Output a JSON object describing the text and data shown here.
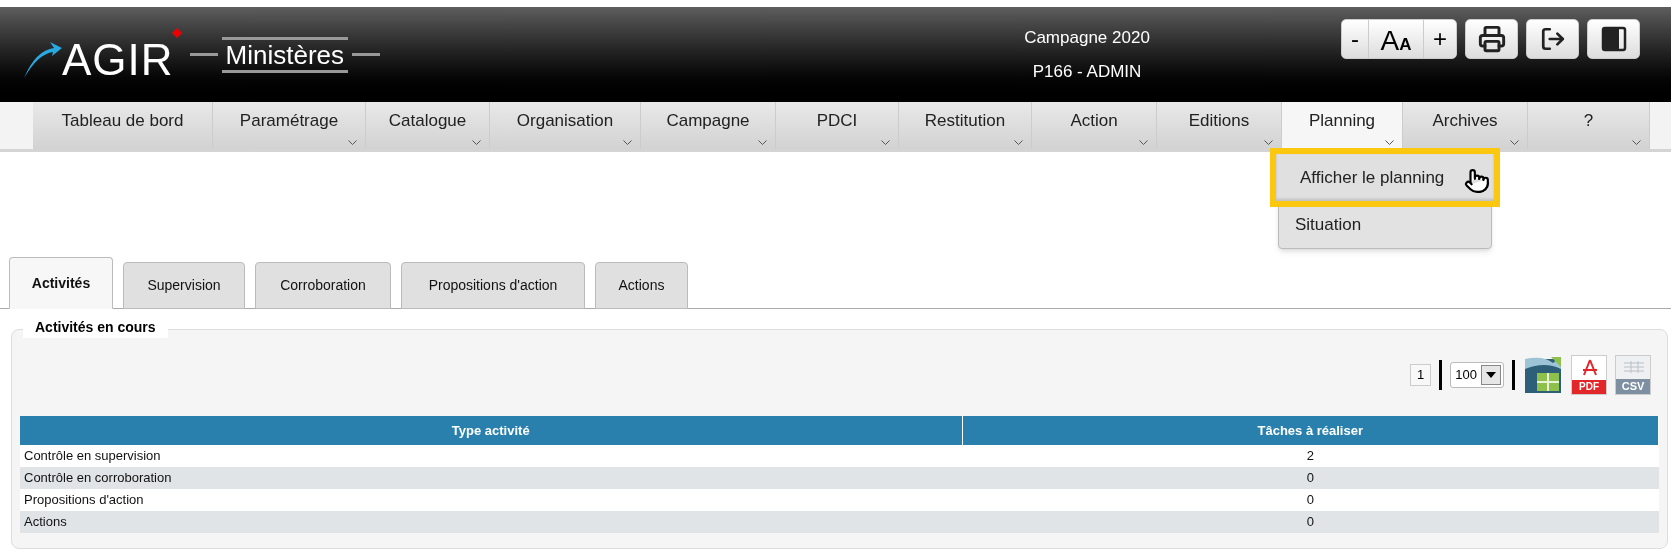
{
  "header": {
    "logo": {
      "brand": "AGIR",
      "subtitle": "Ministères"
    },
    "campaign": "Campagne 2020",
    "user": "P166 - ADMIN",
    "font_controls": {
      "decrease": "-",
      "size_glyphs": [
        "A",
        "A"
      ],
      "increase": "+"
    }
  },
  "menu": [
    {
      "label": "Tableau de bord",
      "has_submenu": false,
      "selected": false
    },
    {
      "label": "Paramétrage",
      "has_submenu": true,
      "selected": false
    },
    {
      "label": "Catalogue",
      "has_submenu": true,
      "selected": false
    },
    {
      "label": "Organisation",
      "has_submenu": true,
      "selected": false
    },
    {
      "label": "Campagne",
      "has_submenu": true,
      "selected": false
    },
    {
      "label": "PDCI",
      "has_submenu": true,
      "selected": false
    },
    {
      "label": "Restitution",
      "has_submenu": true,
      "selected": false
    },
    {
      "label": "Action",
      "has_submenu": true,
      "selected": false
    },
    {
      "label": "Editions",
      "has_submenu": true,
      "selected": false
    },
    {
      "label": "Planning",
      "has_submenu": true,
      "selected": true,
      "submenu": [
        {
          "label": "Afficher le planning",
          "selected": true
        },
        {
          "label": "Situation",
          "selected": false
        }
      ]
    },
    {
      "label": "Archives",
      "has_submenu": true,
      "selected": false
    },
    {
      "label": "?",
      "has_submenu": true,
      "selected": false
    }
  ],
  "tabs": [
    {
      "label": "Activités",
      "selected": true
    },
    {
      "label": "Supervision",
      "selected": false
    },
    {
      "label": "Corroboration",
      "selected": false
    },
    {
      "label": "Propositions d'action",
      "selected": false
    },
    {
      "label": "Actions",
      "selected": false
    }
  ],
  "panel": {
    "legend": "Activités en cours",
    "page": "1",
    "page_size": "100",
    "exports": [
      {
        "kind": "excel"
      },
      {
        "kind": "pdf",
        "label": "PDF"
      },
      {
        "kind": "csv",
        "label": "CSV"
      }
    ],
    "table": {
      "columns": [
        "Type activité",
        "Tâches à réaliser"
      ],
      "rows": [
        [
          "Contrôle en supervision",
          "2"
        ],
        [
          "Contrôle en corroboration",
          "0"
        ],
        [
          "Propositions d'action",
          "0"
        ],
        [
          "Actions",
          "0"
        ]
      ]
    }
  }
}
